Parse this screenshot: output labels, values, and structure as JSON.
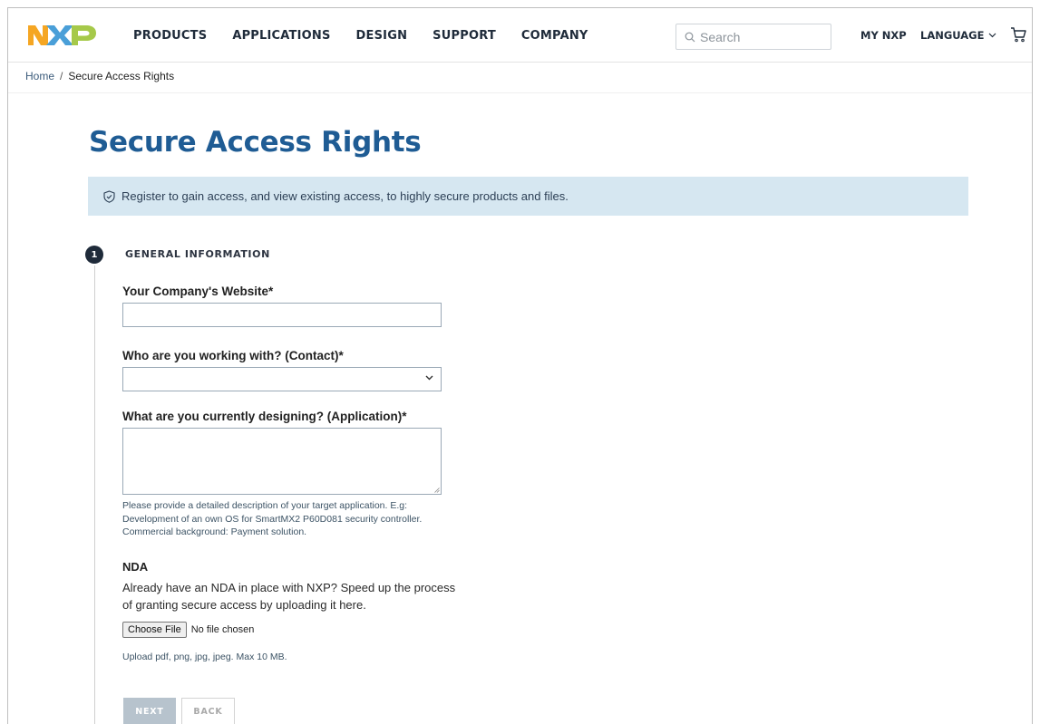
{
  "header": {
    "logo_text": "NXP",
    "nav": [
      {
        "label": "PRODUCTS"
      },
      {
        "label": "APPLICATIONS"
      },
      {
        "label": "DESIGN"
      },
      {
        "label": "SUPPORT"
      },
      {
        "label": "COMPANY"
      }
    ],
    "search_placeholder": "Search",
    "my_nxp": "MY NXP",
    "language": "LANGUAGE",
    "icons": {
      "search": "search-icon",
      "chevron": "chevron-down-icon",
      "cart": "cart-icon"
    }
  },
  "breadcrumb": {
    "home": "Home",
    "separator": "/",
    "current": "Secure Access Rights"
  },
  "page": {
    "title": "Secure Access Rights",
    "banner": "Register to gain access, and view existing access, to highly secure products and files.",
    "banner_icon": "shield-check-icon"
  },
  "step": {
    "number": "1",
    "title": "GENERAL INFORMATION"
  },
  "form": {
    "website_label": "Your Company's Website*",
    "website_value": "",
    "contact_label": "Who are you working with? (Contact)*",
    "contact_value": "",
    "application_label": "What are you currently designing? (Application)*",
    "application_value": "",
    "application_helper": "Please provide a detailed description of your target application. E.g: Development of an own OS for SmartMX2 P60D081 security controller. Commercial background: Payment solution.",
    "nda_label": "NDA",
    "nda_desc": "Already have an NDA in place with NXP? Speed up the process of granting secure access by uploading it here.",
    "file_button": "Choose File",
    "file_status": "No file chosen",
    "upload_hint": "Upload pdf, png, jpg, jpeg. Max 10 MB.",
    "next_label": "NEXT",
    "back_label": "BACK"
  },
  "colors": {
    "brand_blue": "#1f5c94",
    "banner_bg": "#d6e7f1",
    "logo_orange": "#f5a623",
    "logo_blue": "#4a9fd8",
    "logo_green": "#a6c94a"
  }
}
